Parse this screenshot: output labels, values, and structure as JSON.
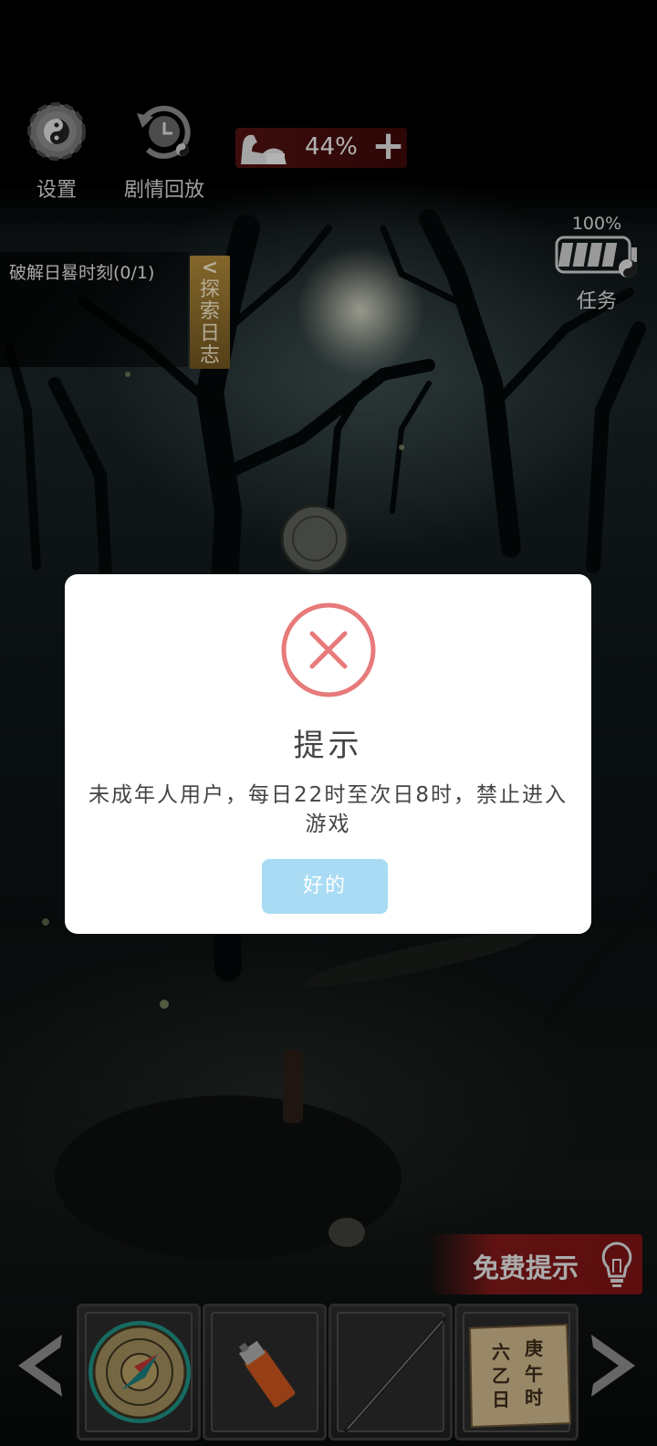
{
  "hud": {
    "settings_label": "设置",
    "replay_label": "剧情回放",
    "energy_percent": "44%",
    "energy_plus": "+",
    "task_percent": "100%",
    "task_label": "任务"
  },
  "quest": {
    "objective": "破解日晷时刻(0/1)",
    "log_tab_arrow": "<",
    "log_tab_label": "探索日志"
  },
  "dialog": {
    "title": "提示",
    "message": "未成年人用户，每日22时至次日8时，禁止进入游戏",
    "ok_label": "好的"
  },
  "hint": {
    "label": "免费提示"
  },
  "inventory": {
    "items": [
      {
        "name": "compass",
        "selected": true
      },
      {
        "name": "lighter",
        "selected": false
      },
      {
        "name": "metal-rod",
        "selected": false
      },
      {
        "name": "paper-scroll",
        "selected": false
      }
    ],
    "scroll_chars": [
      "六",
      "庚",
      "乙",
      "午",
      "日",
      "时"
    ]
  },
  "colors": {
    "error_ring": "#e77a7a",
    "ok_button": "#a9dcf4",
    "hint_bar": "#8c1919",
    "energy_bar": "#5a1414",
    "log_tab": "#8a6a2a"
  }
}
